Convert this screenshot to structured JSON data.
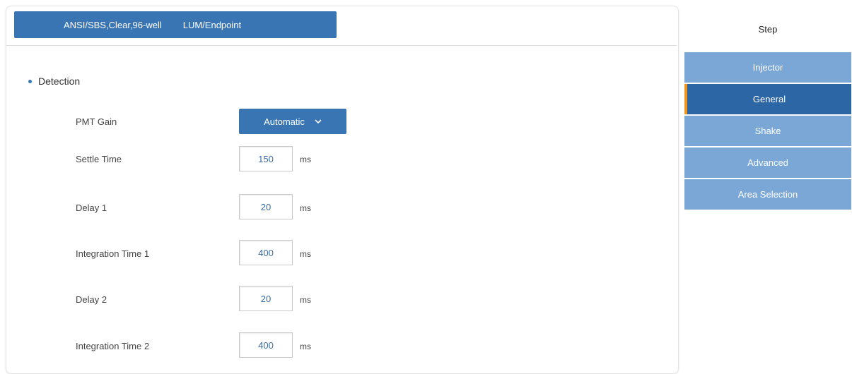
{
  "header": {
    "plate_type": "ANSI/SBS,Clear,96-well",
    "read_mode": "LUM/Endpoint"
  },
  "section": {
    "title": "Detection"
  },
  "fields": {
    "pmt_gain": {
      "label": "PMT Gain",
      "value": "Automatic"
    },
    "settle_time": {
      "label": "Settle Time",
      "value": "150",
      "unit": "ms"
    },
    "delay1": {
      "label": "Delay 1",
      "value": "20",
      "unit": "ms"
    },
    "integration1": {
      "label": "Integration Time 1",
      "value": "400",
      "unit": "ms"
    },
    "delay2": {
      "label": "Delay 2",
      "value": "20",
      "unit": "ms"
    },
    "integration2": {
      "label": "Integration Time 2",
      "value": "400",
      "unit": "ms"
    }
  },
  "sidebar": {
    "title": "Step",
    "items": [
      {
        "label": "Injector"
      },
      {
        "label": "General"
      },
      {
        "label": "Shake"
      },
      {
        "label": "Advanced"
      },
      {
        "label": "Area Selection"
      }
    ],
    "active_index": 1
  },
  "colors": {
    "accent": "#3a75b3",
    "active_step": "#2d66a4",
    "step": "#7aa7d6",
    "indicator": "#f0961f"
  },
  "icons": {
    "dropdown": "chevron-down-icon",
    "section_bullet": "bullet-icon"
  }
}
